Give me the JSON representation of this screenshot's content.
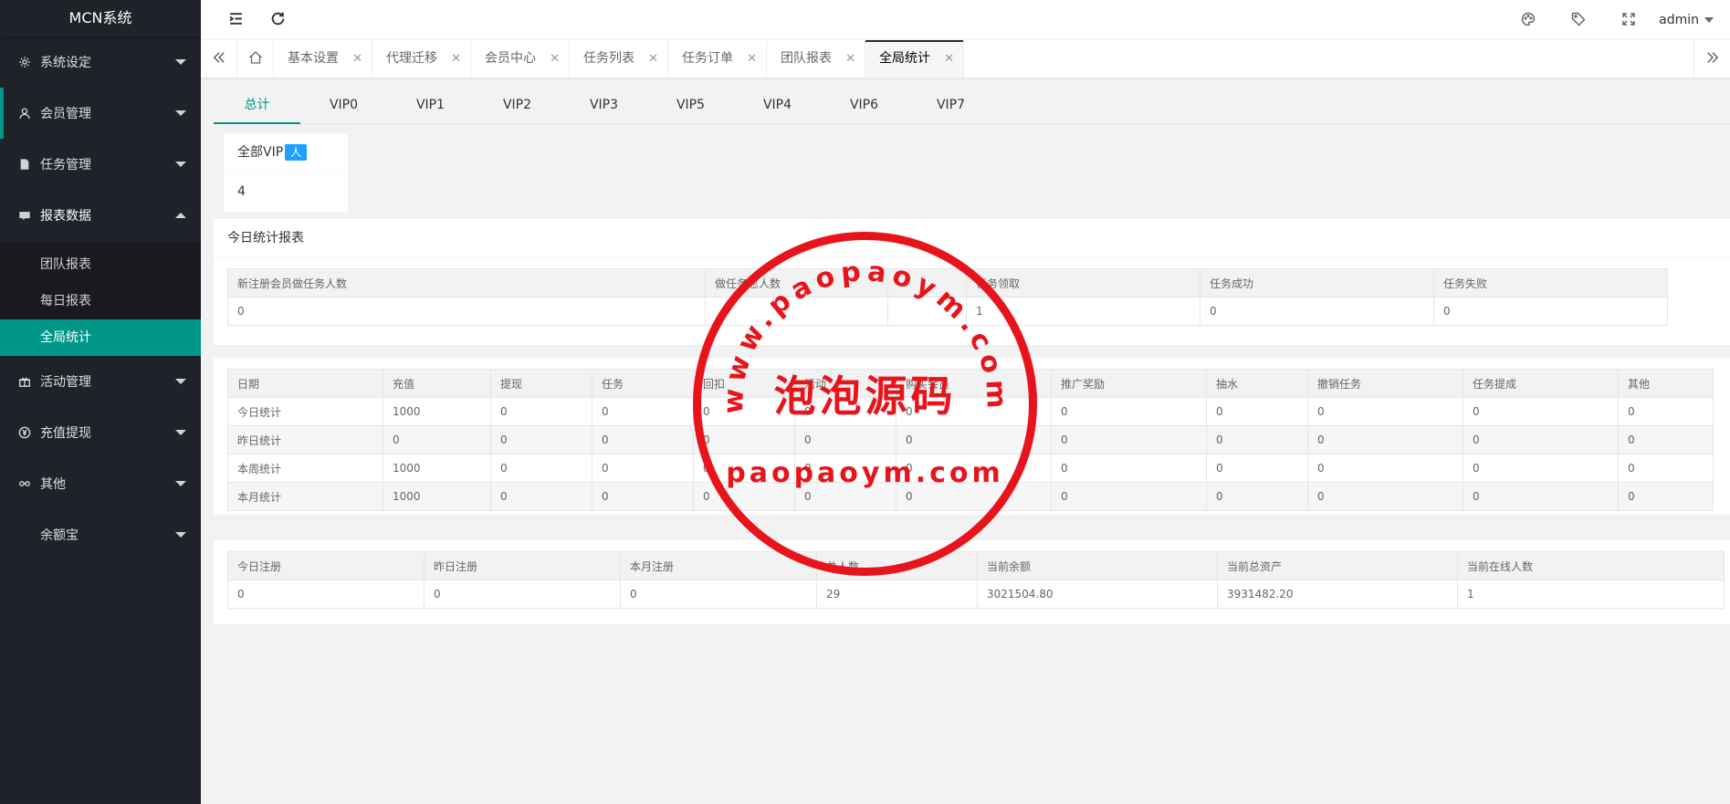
{
  "app": {
    "title": "MCN系统"
  },
  "sidebar": {
    "items": [
      {
        "label": "系统设定",
        "icon": "gear-icon"
      },
      {
        "label": "会员管理",
        "icon": "user-icon"
      },
      {
        "label": "任务管理",
        "icon": "document-icon"
      },
      {
        "label": "报表数据",
        "icon": "report-icon"
      },
      {
        "label": "活动管理",
        "icon": "gift-icon"
      },
      {
        "label": "充值提现",
        "icon": "yen-icon"
      },
      {
        "label": "其他",
        "icon": "link-icon"
      },
      {
        "label": "余额宝",
        "icon": ""
      }
    ],
    "subitems": [
      {
        "label": "团队报表"
      },
      {
        "label": "每日报表"
      },
      {
        "label": "全局统计"
      }
    ]
  },
  "header": {
    "user": "admin"
  },
  "tabs": [
    {
      "label": "基本设置"
    },
    {
      "label": "代理迁移"
    },
    {
      "label": "会员中心"
    },
    {
      "label": "任务列表"
    },
    {
      "label": "任务订单"
    },
    {
      "label": "团队报表"
    },
    {
      "label": "全局统计"
    }
  ],
  "vip_tabs": [
    "总计",
    "VIP0",
    "VIP1",
    "VIP2",
    "VIP3",
    "VIP5",
    "VIP4",
    "VIP6",
    "VIP7"
  ],
  "vip_card": {
    "title": "全部VIP",
    "badge": "人",
    "value": "4"
  },
  "today_report": {
    "title": "今日统计报表",
    "headers": [
      "新注册会员做任务人数",
      "做任务总人数",
      "",
      "任务领取",
      "任务成功",
      "任务失败"
    ],
    "row": [
      "0",
      "",
      "",
      "1",
      "0",
      "0"
    ]
  },
  "finance": {
    "headers": [
      "日期",
      "充值",
      "提现",
      "任务",
      "回扣",
      "活动",
      "购买会员",
      "推广奖励",
      "抽水",
      "撤销任务",
      "任务提成",
      "其他"
    ],
    "rows": [
      [
        "今日统计",
        "1000",
        "0",
        "0",
        "0",
        "0",
        "0",
        "0",
        "0",
        "0",
        "0",
        "0"
      ],
      [
        "昨日统计",
        "0",
        "0",
        "0",
        "0",
        "0",
        "0",
        "0",
        "0",
        "0",
        "0",
        "0"
      ],
      [
        "本周统计",
        "1000",
        "0",
        "0",
        "0",
        "0",
        "0",
        "0",
        "0",
        "0",
        "0",
        "0"
      ],
      [
        "本月统计",
        "1000",
        "0",
        "0",
        "0",
        "0",
        "0",
        "0",
        "0",
        "0",
        "0",
        "0"
      ]
    ]
  },
  "summary": {
    "headers": [
      "今日注册",
      "昨日注册",
      "本月注册",
      "总人数",
      "当前余额",
      "当前总资产",
      "当前在线人数"
    ],
    "row": [
      "0",
      "0",
      "0",
      "29",
      "3021504.80",
      "3931482.20",
      "1"
    ]
  },
  "stamp": {
    "url_top": "www.paopaoym.com",
    "center": "泡泡源码",
    "bottom": "paopaoym.com",
    "color": "#e8141b"
  },
  "colors": {
    "accent": "#009688",
    "sidebar": "#20222a",
    "badge": "#1e9fff"
  }
}
